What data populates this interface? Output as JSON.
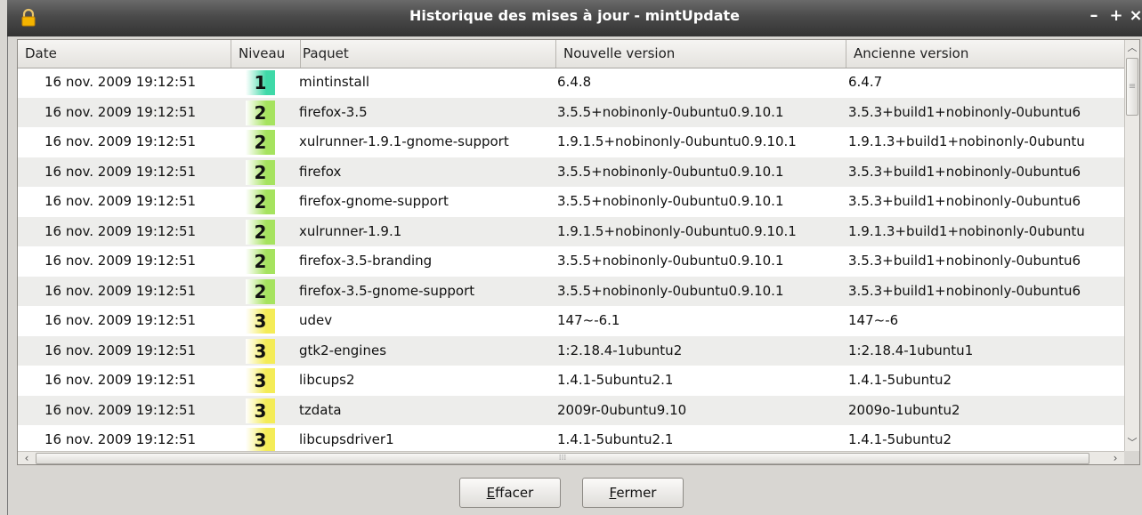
{
  "window": {
    "title": "Historique des mises à jour - mintUpdate",
    "controls": {
      "minimize": "–",
      "maximize": "+",
      "close": "×"
    }
  },
  "columns": {
    "date": "Date",
    "level": "Niveau",
    "package": "Paquet",
    "new_version": "Nouvelle version",
    "old_version": "Ancienne version"
  },
  "level_colors": {
    "1": "#3fd9a8",
    "2": "#a6e35f",
    "3": "#f4ec57"
  },
  "rows": [
    {
      "date": "16 nov. 2009 19:12:51",
      "level": "1",
      "package": "mintinstall",
      "new": "6.4.8",
      "old": "6.4.7"
    },
    {
      "date": "16 nov. 2009 19:12:51",
      "level": "2",
      "package": "firefox-3.5",
      "new": "3.5.5+nobinonly-0ubuntu0.9.10.1",
      "old": "3.5.3+build1+nobinonly-0ubuntu6"
    },
    {
      "date": "16 nov. 2009 19:12:51",
      "level": "2",
      "package": "xulrunner-1.9.1-gnome-support",
      "new": "1.9.1.5+nobinonly-0ubuntu0.9.10.1",
      "old": "1.9.1.3+build1+nobinonly-0ubuntu"
    },
    {
      "date": "16 nov. 2009 19:12:51",
      "level": "2",
      "package": "firefox",
      "new": "3.5.5+nobinonly-0ubuntu0.9.10.1",
      "old": "3.5.3+build1+nobinonly-0ubuntu6"
    },
    {
      "date": "16 nov. 2009 19:12:51",
      "level": "2",
      "package": "firefox-gnome-support",
      "new": "3.5.5+nobinonly-0ubuntu0.9.10.1",
      "old": "3.5.3+build1+nobinonly-0ubuntu6"
    },
    {
      "date": "16 nov. 2009 19:12:51",
      "level": "2",
      "package": "xulrunner-1.9.1",
      "new": "1.9.1.5+nobinonly-0ubuntu0.9.10.1",
      "old": "1.9.1.3+build1+nobinonly-0ubuntu"
    },
    {
      "date": "16 nov. 2009 19:12:51",
      "level": "2",
      "package": "firefox-3.5-branding",
      "new": "3.5.5+nobinonly-0ubuntu0.9.10.1",
      "old": "3.5.3+build1+nobinonly-0ubuntu6"
    },
    {
      "date": "16 nov. 2009 19:12:51",
      "level": "2",
      "package": "firefox-3.5-gnome-support",
      "new": "3.5.5+nobinonly-0ubuntu0.9.10.1",
      "old": "3.5.3+build1+nobinonly-0ubuntu6"
    },
    {
      "date": "16 nov. 2009 19:12:51",
      "level": "3",
      "package": "udev",
      "new": "147~-6.1",
      "old": "147~-6"
    },
    {
      "date": "16 nov. 2009 19:12:51",
      "level": "3",
      "package": "gtk2-engines",
      "new": "1:2.18.4-1ubuntu2",
      "old": "1:2.18.4-1ubuntu1"
    },
    {
      "date": "16 nov. 2009 19:12:51",
      "level": "3",
      "package": "libcups2",
      "new": "1.4.1-5ubuntu2.1",
      "old": "1.4.1-5ubuntu2"
    },
    {
      "date": "16 nov. 2009 19:12:51",
      "level": "3",
      "package": "tzdata",
      "new": "2009r-0ubuntu9.10",
      "old": "2009o-1ubuntu2"
    },
    {
      "date": "16 nov. 2009 19:12:51",
      "level": "3",
      "package": "libcupsdriver1",
      "new": "1.4.1-5ubuntu2.1",
      "old": "1.4.1-5ubuntu2"
    }
  ],
  "buttons": {
    "clear": {
      "mnemonic": "E",
      "rest": "ffacer"
    },
    "close": {
      "mnemonic": "F",
      "rest": "ermer"
    }
  }
}
